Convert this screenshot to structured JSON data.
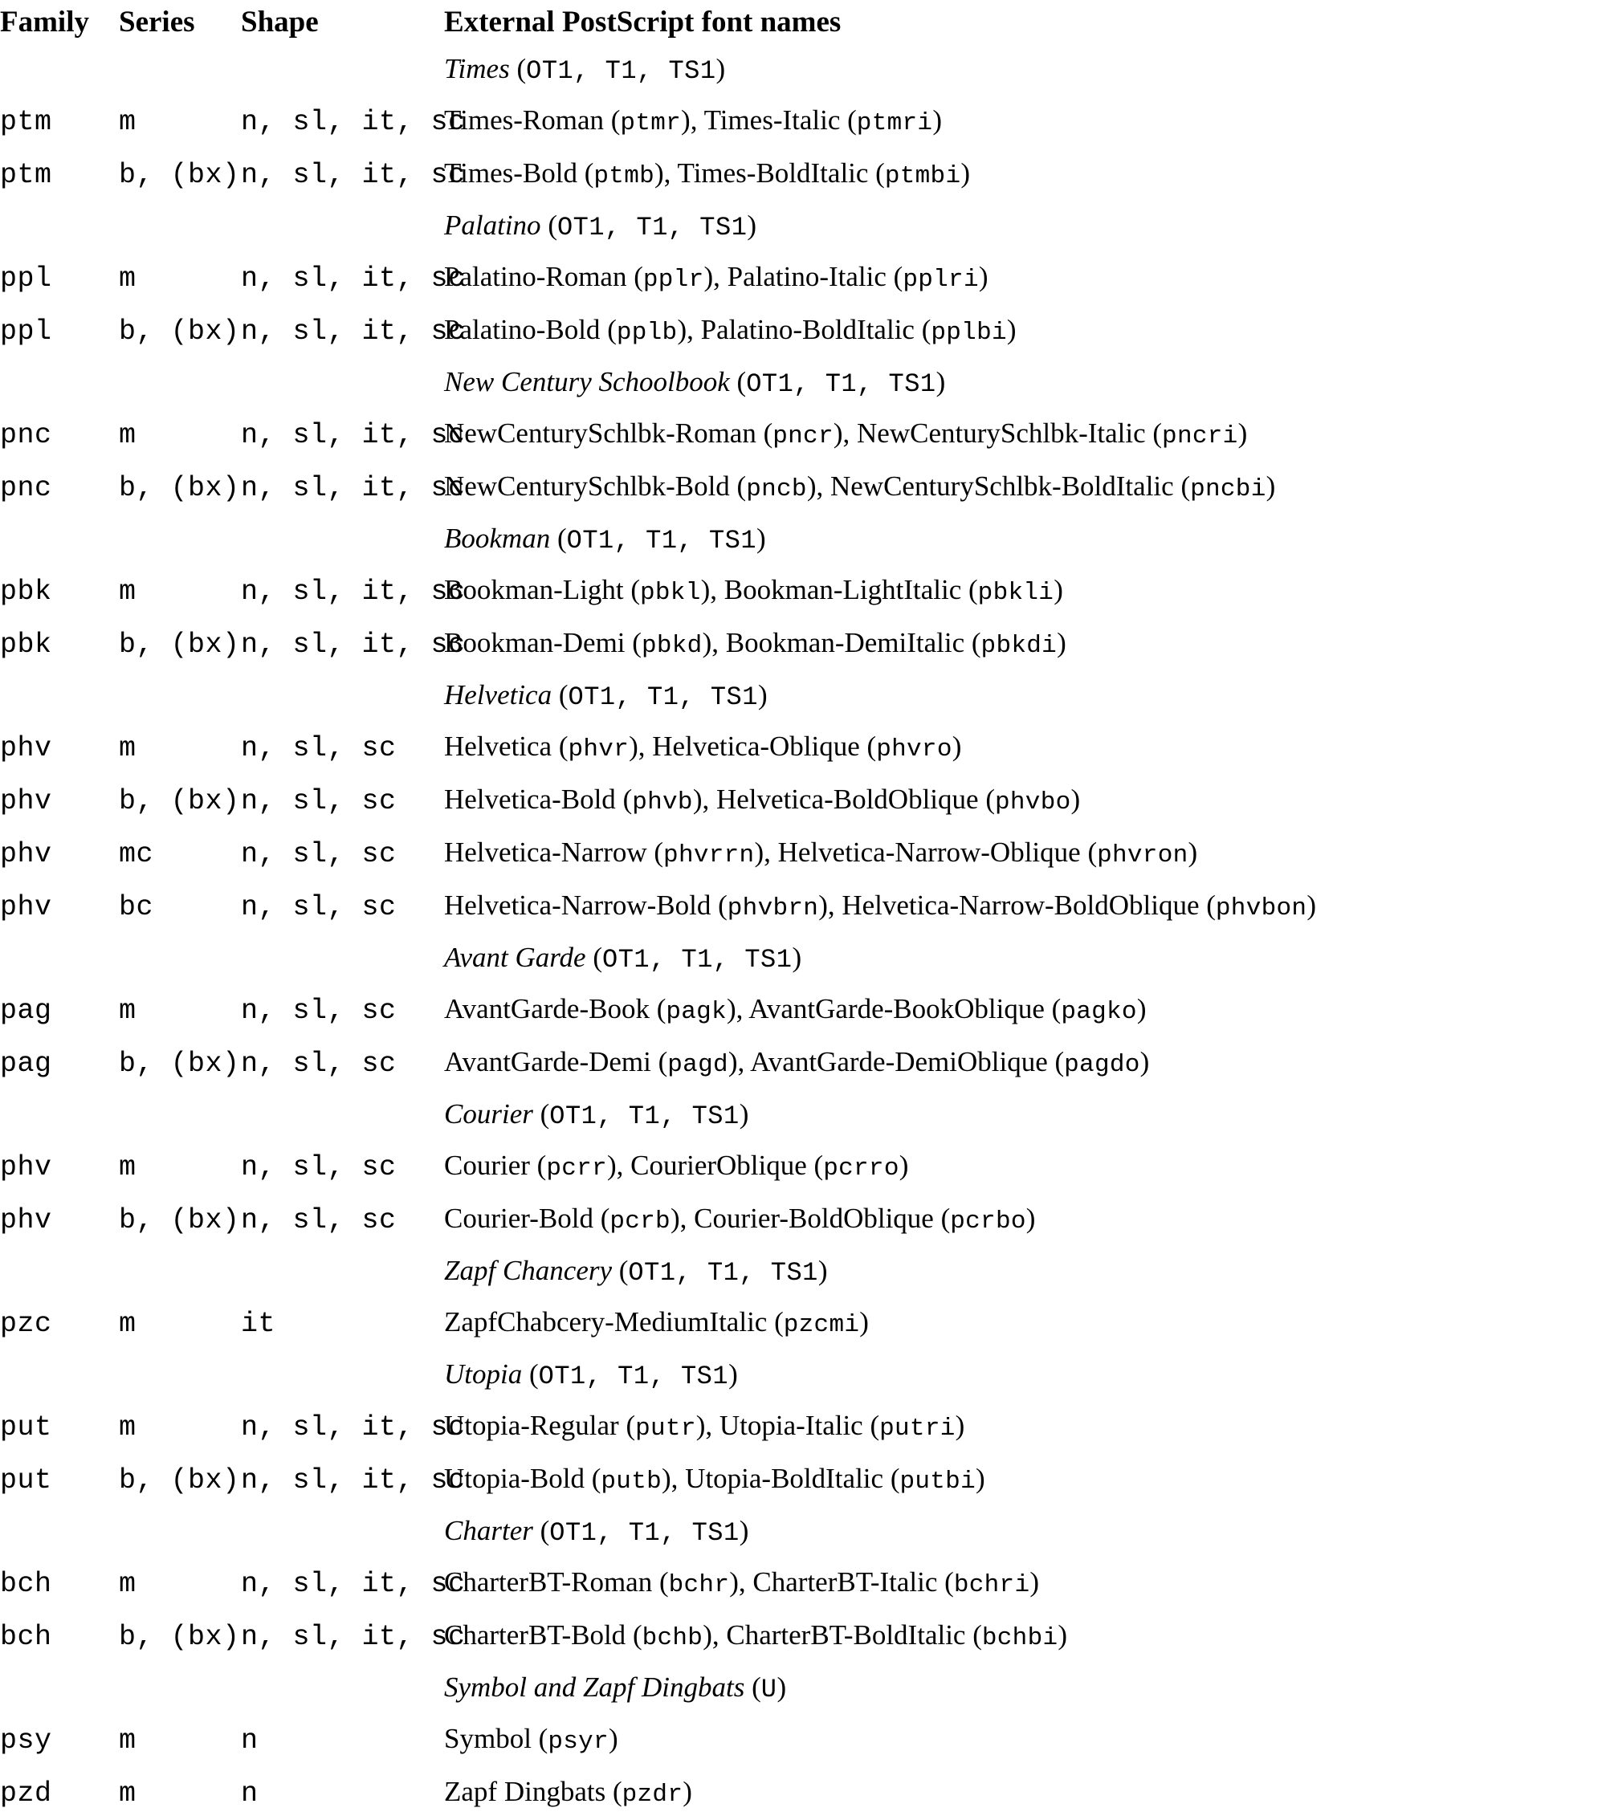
{
  "document": {
    "title": "External PostScript font names"
  },
  "table": {
    "headers": {
      "family": "Family",
      "series": "Series",
      "shape": "Shape",
      "external": "External PostScript font names"
    },
    "sections": [
      {
        "name": "Times",
        "encodings": "OT1, T1, TS1",
        "rows": [
          {
            "family": "ptm",
            "series": "m",
            "shape": "n, sl, it, sc",
            "fonts": [
              {
                "name": "Times-Roman",
                "code": "ptmr"
              },
              {
                "name": "Times-Italic",
                "code": "ptmri"
              }
            ]
          },
          {
            "family": "ptm",
            "series": "b, (bx)",
            "shape": "n, sl, it, sc",
            "fonts": [
              {
                "name": "Times-Bold",
                "code": "ptmb"
              },
              {
                "name": "Times-BoldItalic",
                "code": "ptmbi"
              }
            ]
          }
        ]
      },
      {
        "name": "Palatino",
        "encodings": "OT1, T1, TS1",
        "rows": [
          {
            "family": "ppl",
            "series": "m",
            "shape": "n, sl, it, sc",
            "fonts": [
              {
                "name": "Palatino-Roman",
                "code": "pplr"
              },
              {
                "name": "Palatino-Italic",
                "code": "pplri"
              }
            ]
          },
          {
            "family": "ppl",
            "series": "b, (bx)",
            "shape": "n, sl, it, sc",
            "fonts": [
              {
                "name": "Palatino-Bold",
                "code": "pplb"
              },
              {
                "name": "Palatino-BoldItalic",
                "code": "pplbi"
              }
            ]
          }
        ]
      },
      {
        "name": "New Century Schoolbook",
        "encodings": "OT1, T1, TS1",
        "rows": [
          {
            "family": "pnc",
            "series": "m",
            "shape": "n, sl, it, sc",
            "fonts": [
              {
                "name": "NewCenturySchlbk-Roman",
                "code": "pncr"
              },
              {
                "name": "NewCenturySchlbk-Italic",
                "code": "pncri"
              }
            ]
          },
          {
            "family": "pnc",
            "series": "b, (bx)",
            "shape": "n, sl, it, sc",
            "fonts": [
              {
                "name": "NewCenturySchlbk-Bold",
                "code": "pncb"
              },
              {
                "name": "NewCenturySchlbk-BoldItalic",
                "code": "pncbi"
              }
            ]
          }
        ]
      },
      {
        "name": "Bookman",
        "encodings": "OT1, T1, TS1",
        "rows": [
          {
            "family": "pbk",
            "series": "m",
            "shape": "n, sl, it, sc",
            "fonts": [
              {
                "name": "Bookman-Light",
                "code": "pbkl"
              },
              {
                "name": "Bookman-LightItalic",
                "code": "pbkli"
              }
            ]
          },
          {
            "family": "pbk",
            "series": "b, (bx)",
            "shape": "n, sl, it, sc",
            "fonts": [
              {
                "name": "Bookman-Demi",
                "code": "pbkd"
              },
              {
                "name": "Bookman-DemiItalic",
                "code": "pbkdi"
              }
            ]
          }
        ]
      },
      {
        "name": "Helvetica",
        "encodings": "OT1, T1, TS1",
        "rows": [
          {
            "family": "phv",
            "series": "m",
            "shape": "n, sl, sc",
            "fonts": [
              {
                "name": "Helvetica",
                "code": "phvr"
              },
              {
                "name": "Helvetica-Oblique",
                "code": "phvro"
              }
            ]
          },
          {
            "family": "phv",
            "series": "b, (bx)",
            "shape": "n, sl, sc",
            "fonts": [
              {
                "name": "Helvetica-Bold",
                "code": "phvb"
              },
              {
                "name": "Helvetica-BoldOblique",
                "code": "phvbo"
              }
            ]
          },
          {
            "family": "phv",
            "series": "mc",
            "shape": "n, sl, sc",
            "fonts": [
              {
                "name": "Helvetica-Narrow",
                "code": "phvrrn"
              },
              {
                "name": "Helvetica-Narrow-Oblique",
                "code": "phvron"
              }
            ]
          },
          {
            "family": "phv",
            "series": "bc",
            "shape": "n, sl, sc",
            "fonts": [
              {
                "name": "Helvetica-Narrow-Bold",
                "code": "phvbrn"
              },
              {
                "name": "Helvetica-Narrow-BoldOblique",
                "code": "phvbon"
              }
            ]
          }
        ]
      },
      {
        "name": "Avant Garde",
        "encodings": "OT1, T1, TS1",
        "rows": [
          {
            "family": "pag",
            "series": "m",
            "shape": "n, sl, sc",
            "fonts": [
              {
                "name": "AvantGarde-Book",
                "code": "pagk"
              },
              {
                "name": "AvantGarde-BookOblique",
                "code": "pagko"
              }
            ]
          },
          {
            "family": "pag",
            "series": "b, (bx)",
            "shape": "n, sl, sc",
            "fonts": [
              {
                "name": "AvantGarde-Demi",
                "code": "pagd"
              },
              {
                "name": "AvantGarde-DemiOblique",
                "code": "pagdo"
              }
            ]
          }
        ]
      },
      {
        "name": "Courier",
        "encodings": "OT1, T1, TS1",
        "rows": [
          {
            "family": "phv",
            "series": "m",
            "shape": "n, sl, sc",
            "fonts": [
              {
                "name": "Courier",
                "code": "pcrr"
              },
              {
                "name": "CourierOblique",
                "code": "pcrro"
              }
            ]
          },
          {
            "family": "phv",
            "series": "b, (bx)",
            "shape": "n, sl, sc",
            "fonts": [
              {
                "name": "Courier-Bold",
                "code": "pcrb"
              },
              {
                "name": "Courier-BoldOblique",
                "code": "pcrbo"
              }
            ]
          }
        ]
      },
      {
        "name": "Zapf Chancery",
        "encodings": "OT1, T1, TS1",
        "rows": [
          {
            "family": "pzc",
            "series": "m",
            "shape": "it",
            "fonts": [
              {
                "name": "ZapfChabcery-MediumItalic",
                "code": "pzcmi"
              }
            ]
          }
        ]
      },
      {
        "name": "Utopia",
        "encodings": "OT1, T1, TS1",
        "rows": [
          {
            "family": "put",
            "series": "m",
            "shape": "n, sl, it, sc",
            "fonts": [
              {
                "name": "Utopia-Regular",
                "code": "putr"
              },
              {
                "name": "Utopia-Italic",
                "code": "putri"
              }
            ]
          },
          {
            "family": "put",
            "series": "b, (bx)",
            "shape": "n, sl, it, sc",
            "fonts": [
              {
                "name": "Utopia-Bold",
                "code": "putb"
              },
              {
                "name": "Utopia-BoldItalic",
                "code": "putbi"
              }
            ]
          }
        ]
      },
      {
        "name": "Charter",
        "encodings": "OT1, T1, TS1",
        "rows": [
          {
            "family": "bch",
            "series": "m",
            "shape": "n, sl, it, sc",
            "fonts": [
              {
                "name": "CharterBT-Roman",
                "code": "bchr"
              },
              {
                "name": "CharterBT-Italic",
                "code": "bchri"
              }
            ]
          },
          {
            "family": "bch",
            "series": "b, (bx)",
            "shape": "n, sl, it, sc",
            "fonts": [
              {
                "name": "CharterBT-Bold",
                "code": "bchb"
              },
              {
                "name": "CharterBT-BoldItalic",
                "code": "bchbi"
              }
            ]
          }
        ]
      },
      {
        "name": "Symbol and Zapf Dingbats",
        "encodings": "U",
        "rows": [
          {
            "family": "psy",
            "series": "m",
            "shape": "n",
            "fonts": [
              {
                "name": "Symbol",
                "code": "psyr"
              }
            ]
          },
          {
            "family": "pzd",
            "series": "m",
            "shape": "n",
            "fonts": [
              {
                "name": "Zapf Dingbats",
                "code": "pzdr"
              }
            ]
          }
        ]
      }
    ]
  }
}
